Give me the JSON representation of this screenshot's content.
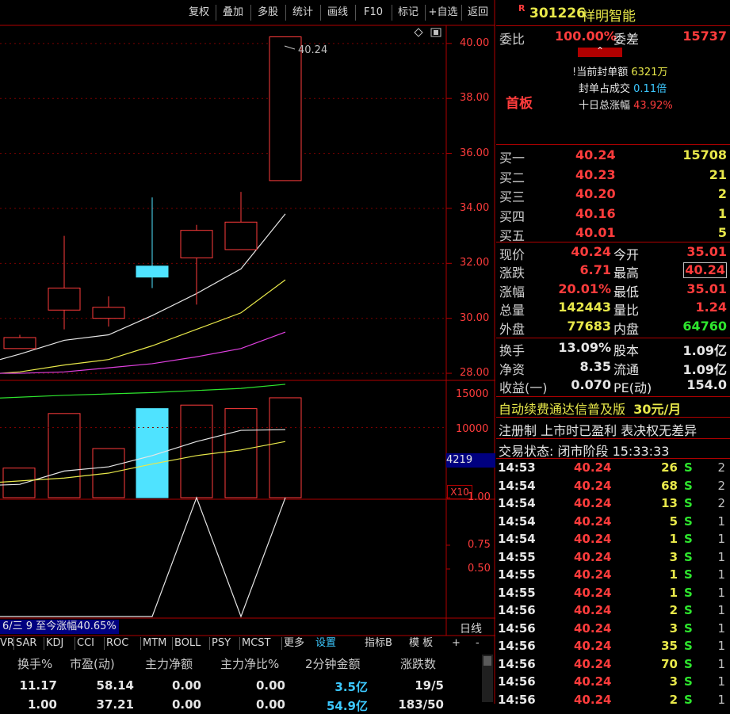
{
  "toolbar": {
    "buttons": [
      "复权",
      "叠加",
      "多股",
      "统计",
      "画线",
      "F10",
      "标记",
      "+自选",
      "返回"
    ]
  },
  "chart": {
    "price_axis": [
      "40.00",
      "38.00",
      "36.00",
      "34.00",
      "32.00",
      "30.00",
      "28.00"
    ],
    "high_label": "40.24",
    "volume_axis": [
      "15000",
      "10000"
    ],
    "volume_current": "4219",
    "volume_unit": "X10",
    "indicator_axis": [
      "1.00",
      "0.75",
      "0.50"
    ],
    "info_bar": "6/三  9 至今涨幅40.65%",
    "period": "日线"
  },
  "chart_data": {
    "type": "candlestick",
    "candles": [
      {
        "open": 28.9,
        "close": 29.3,
        "high": 29.4,
        "low": 28.9
      },
      {
        "open": 30.3,
        "close": 31.1,
        "high": 33.0,
        "low": 29.6
      },
      {
        "open": 30.0,
        "close": 30.4,
        "high": 30.8,
        "low": 29.7
      },
      {
        "open": 31.9,
        "close": 31.5,
        "high": 34.4,
        "low": 31.1
      },
      {
        "open": 32.2,
        "close": 33.2,
        "high": 33.4,
        "low": 30.5
      },
      {
        "open": 32.5,
        "close": 33.5,
        "high": 34.6,
        "low": 32.5
      },
      {
        "open": 35.01,
        "close": 40.24,
        "high": 40.24,
        "low": 35.01
      }
    ],
    "volumes": [
      4219,
      12000,
      7000,
      12700,
      13200,
      12700,
      14244
    ],
    "ylim": [
      27.8,
      40.6
    ]
  },
  "stock": {
    "marker": "R",
    "code": "301226",
    "name": "祥明智能"
  },
  "order": {
    "weibi_label": "委比",
    "weibi_value": "100.00%",
    "weicha_label": "委差",
    "weicha_value": "15737",
    "status": "首板",
    "seal_amount_label": "当前封单额",
    "seal_amount": "6321万",
    "seal_ratio_label": "封单占成交",
    "seal_ratio": "0.11倍",
    "ten_day_label": "十日总涨幅",
    "ten_day": "43.92%"
  },
  "bids": [
    {
      "label": "买一",
      "price": "40.24",
      "vol": "15708"
    },
    {
      "label": "买二",
      "price": "40.23",
      "vol": "21"
    },
    {
      "label": "买三",
      "price": "40.20",
      "vol": "2"
    },
    {
      "label": "买四",
      "price": "40.16",
      "vol": "1"
    },
    {
      "label": "买五",
      "price": "40.01",
      "vol": "5"
    }
  ],
  "quote": [
    {
      "l1": "现价",
      "v1": "40.24",
      "l2": "今开",
      "v2": "35.01"
    },
    {
      "l1": "涨跌",
      "v1": "6.71",
      "l2": "最高",
      "v2": "40.24"
    },
    {
      "l1": "涨幅",
      "v1": "20.01%",
      "l2": "最低",
      "v2": "35.01"
    },
    {
      "l1": "总量",
      "v1": "142443",
      "l2": "量比",
      "v2": "1.24"
    },
    {
      "l1": "外盘",
      "v1": "77683",
      "l2": "内盘",
      "v2": "64760"
    }
  ],
  "fundamentals": [
    {
      "l1": "换手",
      "v1": "13.09%",
      "l2": "股本",
      "v2": "1.09亿"
    },
    {
      "l1": "净资",
      "v1": "8.35",
      "l2": "流通",
      "v2": "1.09亿"
    },
    {
      "l1": "收益(一)",
      "v1": "0.070",
      "l2": "PE(动)",
      "v2": "154.0"
    }
  ],
  "ad_text": "自动续费通达信普及版",
  "ad_price": "30元/月",
  "registration": "注册制 上市时已盈利 表决权无差异",
  "trade_status": "交易状态: 闭市阶段 15:33:33",
  "ticks": [
    {
      "t": "14:53",
      "p": "40.24",
      "v": "26",
      "s": "S",
      "n": "2"
    },
    {
      "t": "14:54",
      "p": "40.24",
      "v": "68",
      "s": "S",
      "n": "2"
    },
    {
      "t": "14:54",
      "p": "40.24",
      "v": "13",
      "s": "S",
      "n": "2"
    },
    {
      "t": "14:54",
      "p": "40.24",
      "v": "5",
      "s": "S",
      "n": "1"
    },
    {
      "t": "14:54",
      "p": "40.24",
      "v": "1",
      "s": "S",
      "n": "1"
    },
    {
      "t": "14:55",
      "p": "40.24",
      "v": "3",
      "s": "S",
      "n": "1"
    },
    {
      "t": "14:55",
      "p": "40.24",
      "v": "1",
      "s": "S",
      "n": "1"
    },
    {
      "t": "14:55",
      "p": "40.24",
      "v": "1",
      "s": "S",
      "n": "1"
    },
    {
      "t": "14:56",
      "p": "40.24",
      "v": "2",
      "s": "S",
      "n": "1"
    },
    {
      "t": "14:56",
      "p": "40.24",
      "v": "3",
      "s": "S",
      "n": "1"
    },
    {
      "t": "14:56",
      "p": "40.24",
      "v": "35",
      "s": "S",
      "n": "1"
    },
    {
      "t": "14:56",
      "p": "40.24",
      "v": "70",
      "s": "S",
      "n": "1"
    },
    {
      "t": "14:56",
      "p": "40.24",
      "v": "3",
      "s": "S",
      "n": "1"
    },
    {
      "t": "14:56",
      "p": "40.24",
      "v": "2",
      "s": "S",
      "n": "1"
    }
  ],
  "tabs": [
    "VR",
    "SAR",
    "KDJ",
    "CCI",
    "ROC",
    "MTM",
    "BOLL",
    "PSY",
    "MCST",
    "更多",
    "设置",
    "指标B",
    "模 板",
    "+",
    "-"
  ],
  "grid": {
    "headers": [
      "换手%",
      "市盈(动)",
      "主力净额",
      "主力净比%",
      "2分钟金额",
      "涨跌数"
    ],
    "rows": [
      [
        "11.17",
        "58.14",
        "0.00",
        "0.00",
        "3.5亿",
        "19/5"
      ],
      [
        "1.00",
        "37.21",
        "0.00",
        "0.00",
        "54.9亿",
        "183/50"
      ]
    ]
  }
}
